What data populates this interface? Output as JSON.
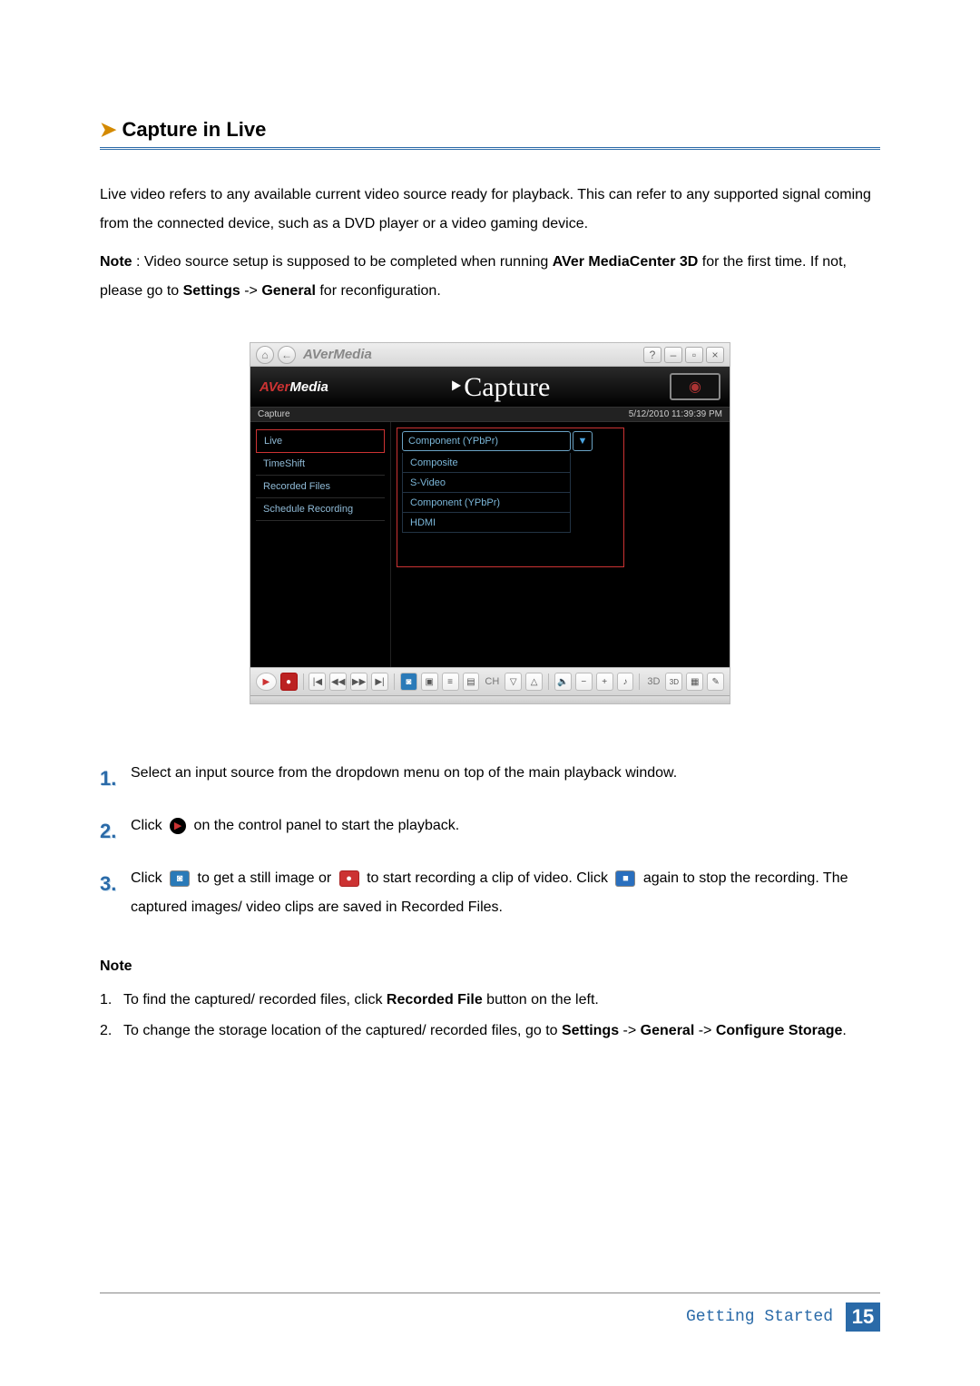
{
  "heading": "Capture in Live",
  "para1": "Live video refers to any available current video source ready for playback. This can refer to any supported signal coming from the connected device, such as a DVD player or a video gaming device.",
  "note_para_prefix": "Note",
  "note_para_1": " : Video source setup is supposed to be completed when running ",
  "note_para_bold1": "AVer MediaCenter 3D",
  "note_para_2": " for the first time. If not, please go to ",
  "note_para_bold2": "Settings",
  "note_para_3": " -> ",
  "note_para_bold3": "General",
  "note_para_4": " for reconfiguration.",
  "screenshot": {
    "titlebar_brand": "AVerMedia",
    "logo_prefix": "AVer",
    "logo_suffix": "Media",
    "capture_title": "Capture",
    "subbar_left": "Capture",
    "subbar_right": "5/12/2010 11:39:39 PM",
    "sidebar": [
      "Live",
      "TimeShift",
      "Recorded Files",
      "Schedule Recording"
    ],
    "dropdown_selected": "Component (YPbPr)",
    "dropdown_options": [
      "Composite",
      "S-Video",
      "Component (YPbPr)",
      "HDMI"
    ],
    "controls": {
      "ch": "CH",
      "threeD": "3D",
      "threeD_small": "3D"
    }
  },
  "steps": {
    "s1": "Select an input source from the dropdown menu on top of the main playback window.",
    "s2a": "Click ",
    "s2b": " on the control panel to start the playback.",
    "s3a": "Click ",
    "s3b": " to get a still image or ",
    "s3c": " to start recording a clip of video. Click ",
    "s3d": " again to stop the recording. The captured images/ video clips are saved in Recorded Files."
  },
  "notes_title": "Note",
  "notes": {
    "n1a": "To find the captured/ recorded files, click ",
    "n1b": "Recorded File",
    "n1c": " button on the left.",
    "n2a": "To change the storage location of the captured/ recorded files, go to ",
    "n2b": "Settings",
    "n2c": " -> ",
    "n2d": "General",
    "n2e": " -> ",
    "n2f": "Configure Storage",
    "n2g": "."
  },
  "footer_section": "Getting Started",
  "footer_page": "15"
}
